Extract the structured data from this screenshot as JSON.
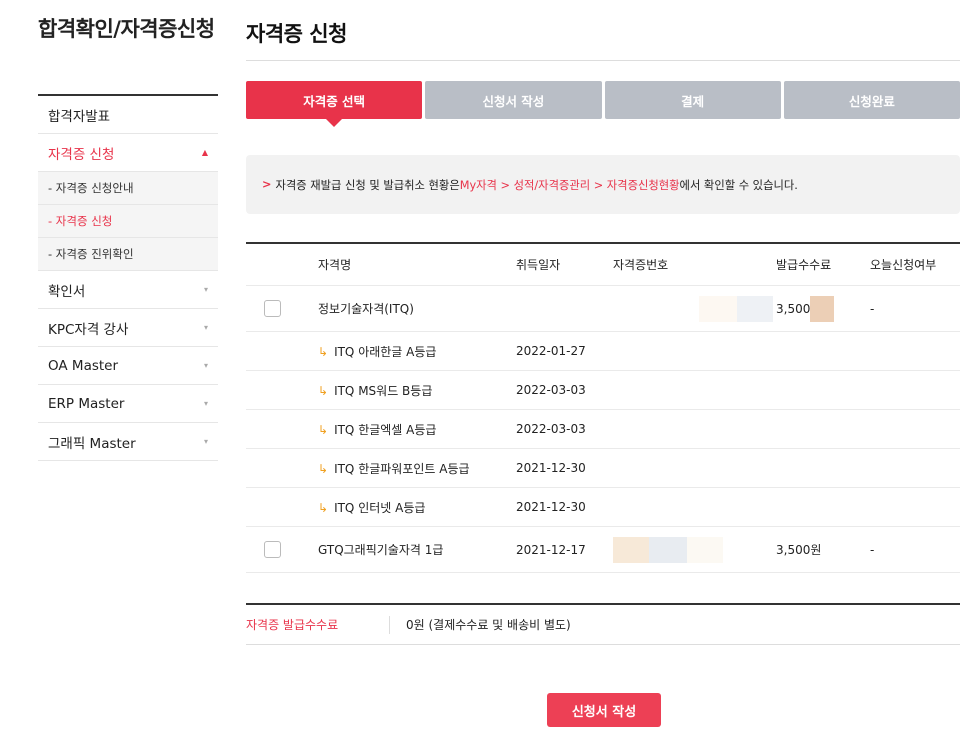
{
  "sidebar": {
    "title": "합격확인/자격증신청",
    "items": [
      {
        "label": "합격자발표",
        "arrow": ""
      },
      {
        "label": "자격증 신청",
        "arrow": "▲"
      },
      {
        "label": "확인서",
        "arrow": "▾"
      },
      {
        "label": "KPC자격 강사",
        "arrow": "▾"
      },
      {
        "label": "OA Master",
        "arrow": "▾"
      },
      {
        "label": "ERP Master",
        "arrow": "▾"
      },
      {
        "label": "그래픽 Master",
        "arrow": "▾"
      }
    ],
    "sub_items": [
      {
        "label": "- 자격증 신청안내"
      },
      {
        "label": "- 자격증 신청"
      },
      {
        "label": "- 자격증 진위확인"
      }
    ]
  },
  "page": {
    "title": "자격증 신청"
  },
  "steps": [
    {
      "label": "자격증 선택"
    },
    {
      "label": "신청서 작성"
    },
    {
      "label": "결제"
    },
    {
      "label": "신청완료"
    }
  ],
  "notice": {
    "marker": ">",
    "text_before": "자격증 재발급 신청 및 발급취소 현황은 ",
    "highlight": "My자격 > 성적/자격증관리 > 자격증신청현황",
    "text_after": "에서 확인할 수 있습니다."
  },
  "table": {
    "headers": {
      "name": "자격명",
      "date": "취득일자",
      "number": "자격증번호",
      "fee": "발급수수료",
      "today": "오늘신청여부"
    },
    "rows": [
      {
        "name": "정보기술자격(ITQ)",
        "date": "",
        "fee": "3,500원",
        "today": "-"
      },
      {
        "name": "ITQ 아래한글 A등급",
        "date": "2022-01-27"
      },
      {
        "name": "ITQ MS워드 B등급",
        "date": "2022-03-03"
      },
      {
        "name": "ITQ 한글엑셀 A등급",
        "date": "2022-03-03"
      },
      {
        "name": "ITQ 한글파워포인트 A등급",
        "date": "2021-12-30"
      },
      {
        "name": "ITQ 인터넷 A등급",
        "date": "2021-12-30"
      },
      {
        "name": "GTQ그래픽기술자격 1급",
        "date": "2021-12-17",
        "fee": "3,500원",
        "today": "-"
      }
    ]
  },
  "fee_summary": {
    "label": "자격증 발급수수료",
    "value": "0원 (결제수수료 및 배송비 별도)"
  },
  "submit": {
    "label": "신청서 작성"
  },
  "icons": {
    "sub_arrow": "↳"
  },
  "colors": {
    "accent": "#e8334a",
    "step_inactive": "#b9bec6",
    "sub_arrow": "#f0a020"
  }
}
